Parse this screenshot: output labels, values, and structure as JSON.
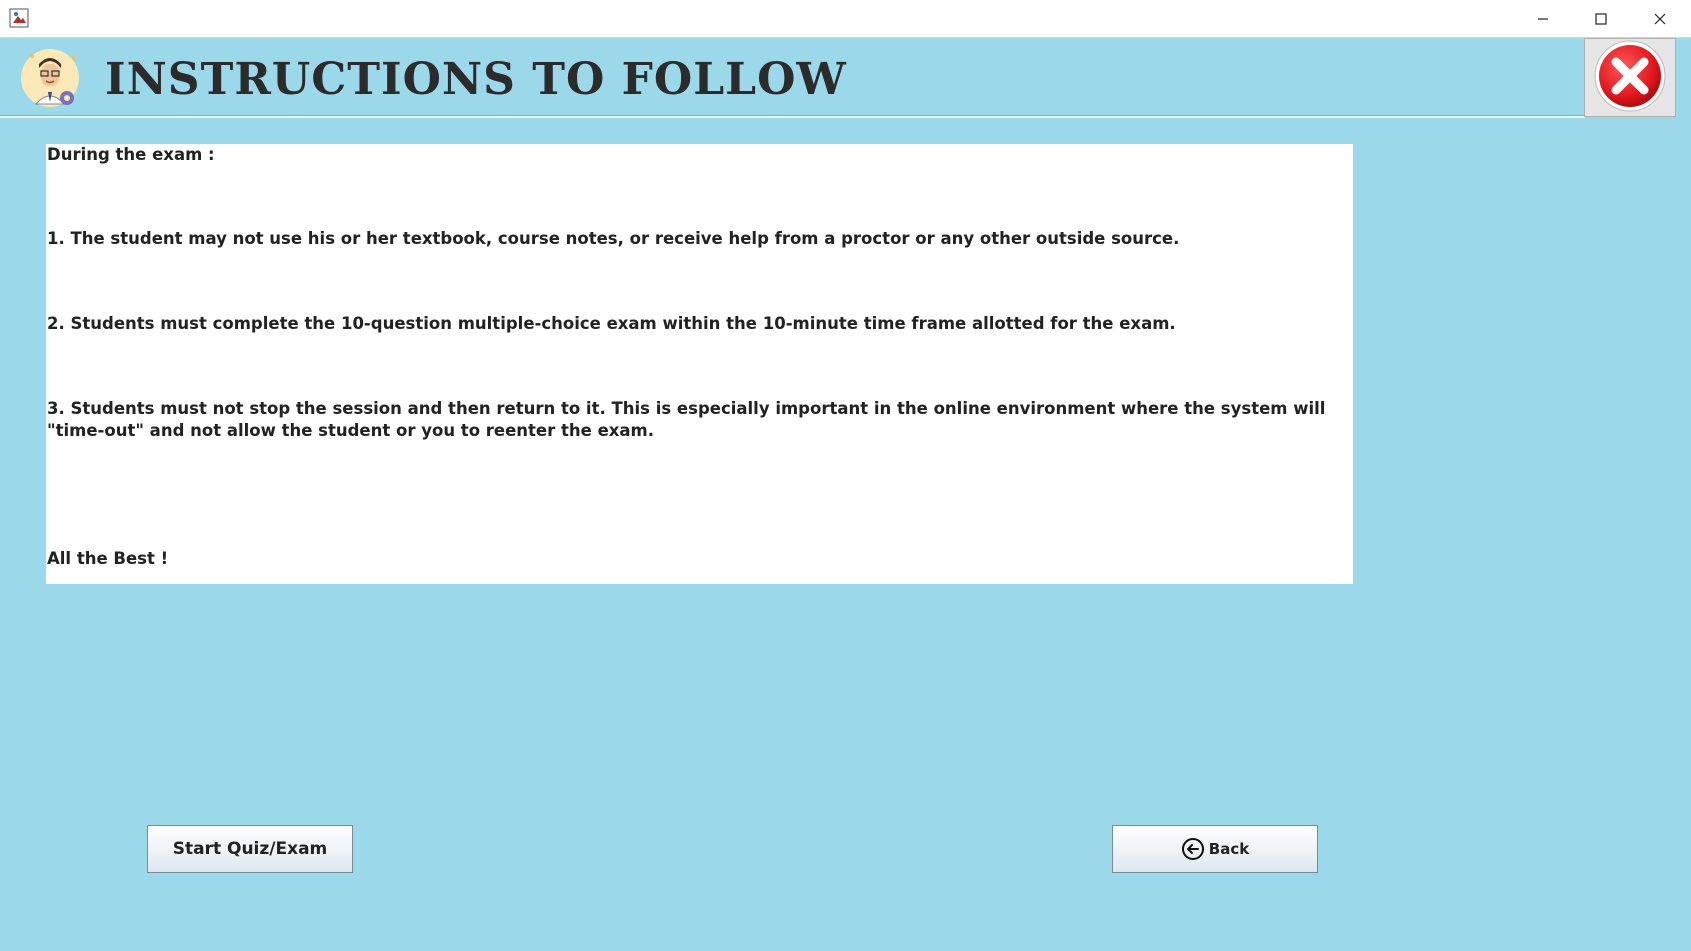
{
  "window": {
    "controls": {
      "minimize_icon": "minimize-icon",
      "maximize_icon": "maximize-icon",
      "close_icon": "close-icon"
    }
  },
  "header": {
    "title": "INSTRUCTIONS TO FOLLOW",
    "avatar_icon": "teacher-avatar-icon",
    "close_button_icon": "red-close-icon"
  },
  "instructions": {
    "heading": "During the exam :",
    "rule_1": "1. The student may not use his or her textbook, course notes, or receive help from a proctor or any other outside source.",
    "rule_2": "2. Students must complete the 10-question multiple-choice exam within the 10-minute time frame allotted for the exam.",
    "rule_3_line_1": "3. Students must not stop the session and then return to it. This is especially important in the online environment where the system will",
    "rule_3_line_2": "\"time-out\" and not allow the student or you to reenter the exam.",
    "closing": "All the Best !"
  },
  "buttons": {
    "start_label": "Start Quiz/Exam",
    "back_label": "Back",
    "back_icon": "arrow-left-circle-icon"
  },
  "colors": {
    "background": "#9ad8ea",
    "panel": "#ffffff",
    "close_red": "#e0161c"
  }
}
